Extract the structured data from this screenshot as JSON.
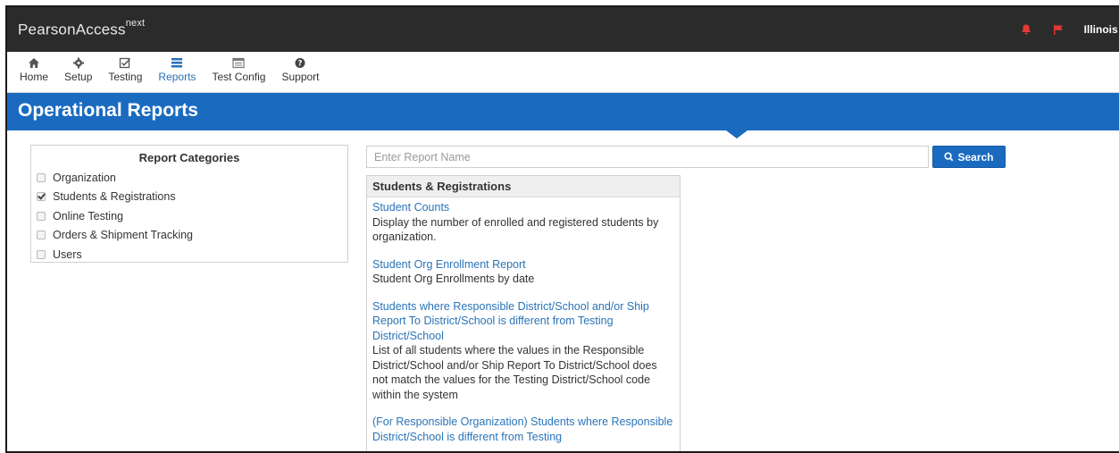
{
  "app": {
    "brand_main": "PearsonAccess",
    "brand_sup": "next"
  },
  "header": {
    "state_label": "Illinois :"
  },
  "nav": [
    {
      "label": "Home",
      "icon": "home-icon",
      "active": false
    },
    {
      "label": "Setup",
      "icon": "gear-icon",
      "active": false
    },
    {
      "label": "Testing",
      "icon": "checkbox-icon",
      "active": false
    },
    {
      "label": "Reports",
      "icon": "reports-icon",
      "active": true
    },
    {
      "label": "Test Config",
      "icon": "test-config-icon",
      "active": false
    },
    {
      "label": "Support",
      "icon": "help-icon",
      "active": false
    }
  ],
  "page": {
    "title": "Operational Reports"
  },
  "categories": {
    "title": "Report Categories",
    "items": [
      {
        "label": "Organization",
        "checked": false
      },
      {
        "label": "Students & Registrations",
        "checked": true
      },
      {
        "label": "Online Testing",
        "checked": false
      },
      {
        "label": "Orders & Shipment Tracking",
        "checked": false
      },
      {
        "label": "Users",
        "checked": false
      }
    ]
  },
  "search": {
    "placeholder": "Enter Report Name",
    "button_label": "Search"
  },
  "results": {
    "heading": "Students & Registrations",
    "reports": [
      {
        "title": "Student Counts",
        "description": "Display the number of enrolled and registered students by organization."
      },
      {
        "title": "Student Org Enrollment Report",
        "description": "Student Org Enrollments by date"
      },
      {
        "title": "Students where Responsible District/School and/or Ship Report To District/School is different from Testing District/School",
        "description": "List of all students where the values in the Responsible District/School and/or Ship Report To District/School does not match the values for the Testing District/School code within the system"
      },
      {
        "title": "(For Responsible Organization) Students where Responsible District/School is different from Testing",
        "description": ""
      }
    ]
  },
  "colors": {
    "topbar": "#2b2b2b",
    "accent_blue": "#1a6bc0",
    "link": "#2a74b8",
    "alert_red": "#e53935"
  }
}
